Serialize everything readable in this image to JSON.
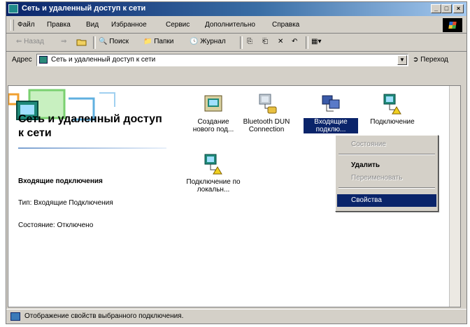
{
  "window": {
    "title": "Сеть и удаленный доступ к сети",
    "buttons": {
      "minimize": "_",
      "maximize": "□",
      "close": "×"
    }
  },
  "menubar": {
    "items": [
      "Файл",
      "Правка",
      "Вид",
      "Избранное",
      "Сервис",
      "Дополнительно",
      "Справка"
    ]
  },
  "toolbar": {
    "back": "⇐ Назад",
    "forward": "⇒",
    "search": "Поиск",
    "folders": "Папки",
    "history": "Журнал",
    "move_to": "⎘",
    "copy_to": "⎗",
    "delete": "✕",
    "undo": "↶",
    "views": "▦▾"
  },
  "addressbar": {
    "label": "Адрес",
    "value": "Сеть и удаленный доступ к сети",
    "go": "Переход"
  },
  "left_pane": {
    "title": "Сеть и удаленный доступ к сети",
    "selected_name": "Входящие подключения",
    "type_line": "Тип: Входящие Подключения",
    "state_line": "Состояние: Отключено"
  },
  "icons": [
    {
      "label": "Создание нового под...",
      "icon": "new-connection-icon",
      "selected": false
    },
    {
      "label": "Bluetooth DUN Connection",
      "icon": "dialup-connection-icon",
      "selected": false
    },
    {
      "label": "Входящие подклю...",
      "icon": "incoming-connections-icon",
      "selected": true
    },
    {
      "label": "Подключение",
      "icon": "network-connection-icon",
      "selected": false
    },
    {
      "label": "Подключение по локальн...",
      "icon": "lan-connection-icon",
      "selected": false
    }
  ],
  "context_menu": {
    "items": [
      {
        "label": "Состояние",
        "state": "disabled"
      },
      {
        "label": "Удалить",
        "state": "bold"
      },
      {
        "label": "Переименовать",
        "state": "disabled"
      },
      {
        "label": "Свойства",
        "state": "highlighted"
      }
    ]
  },
  "statusbar": {
    "text": "Отображение свойств выбранного подключения."
  },
  "colors": {
    "titlebar_start": "#0a246a",
    "titlebar_end": "#a6caf0",
    "face": "#d4d0c8",
    "highlight": "#0a246a"
  }
}
